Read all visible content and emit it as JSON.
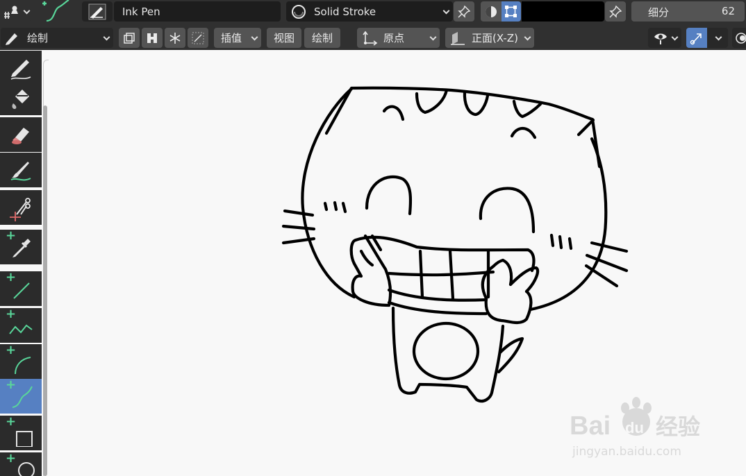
{
  "header": {
    "brush_name": "Ink Pen",
    "material_name": "Solid Stroke",
    "subdivision_label": "细分",
    "subdivision_value": "62"
  },
  "toolbar2": {
    "mode": "绘制",
    "interpolate": "插值",
    "view_label": "视图",
    "draw_label": "绘制",
    "origin": "原点",
    "plane": "正面(X-Z)"
  },
  "tools": [
    {
      "name": "draw",
      "icon": "pencil-icon"
    },
    {
      "name": "fill",
      "icon": "fill-bucket-icon"
    },
    {
      "name": "erase",
      "icon": "eraser-icon"
    },
    {
      "name": "tint",
      "icon": "tint-brush-icon"
    },
    {
      "name": "cutter",
      "icon": "scissors-icon"
    },
    {
      "name": "eyedropper",
      "icon": "eyedropper-icon"
    },
    {
      "name": "line",
      "icon": "line-icon"
    },
    {
      "name": "polyline",
      "icon": "polyline-icon"
    },
    {
      "name": "arc",
      "icon": "arc-icon"
    },
    {
      "name": "curve",
      "icon": "curve-icon",
      "active": true
    },
    {
      "name": "box",
      "icon": "box-icon"
    },
    {
      "name": "circle",
      "icon": "circle-icon"
    }
  ],
  "colors": {
    "accent": "#5680c2",
    "add_green": "#59d69a",
    "stroke": "#000000",
    "panel": "#303030"
  },
  "watermark": {
    "brand": "Bai",
    "brand2": "du",
    "cn": "经验",
    "url": "jingyan.baidu.com"
  }
}
